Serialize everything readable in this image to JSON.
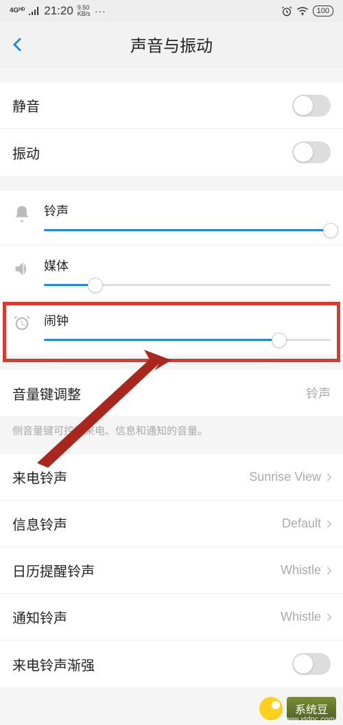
{
  "status_bar": {
    "network": "4Gᴴᴰ",
    "time": "21:20",
    "speed_top": "9.50",
    "speed_bottom": "KB/s",
    "dots": "···",
    "battery": "100"
  },
  "header": {
    "title": "声音与振动"
  },
  "toggles": {
    "mute_label": "静音",
    "vibrate_label": "振动"
  },
  "volumes": {
    "ringtone": {
      "label": "铃声",
      "value": 100
    },
    "media": {
      "label": "媒体",
      "value": 18
    },
    "alarm": {
      "label": "闹钟",
      "value": 82
    }
  },
  "vol_key": {
    "label": "音量键调整",
    "value": "铃声",
    "desc": "侧音量键可控制来电、信息和通知的音量。"
  },
  "ringtones": {
    "call": {
      "label": "来电铃声",
      "value": "Sunrise View"
    },
    "message": {
      "label": "信息铃声",
      "value": "Default"
    },
    "calendar": {
      "label": "日历提醒铃声",
      "value": "Whistle"
    },
    "notify": {
      "label": "通知铃声",
      "value": "Whistle"
    },
    "fade_in": {
      "label": "来电铃声渐强"
    }
  },
  "watermark": {
    "text": "系统豆",
    "url": "www.xtdpc.com"
  }
}
